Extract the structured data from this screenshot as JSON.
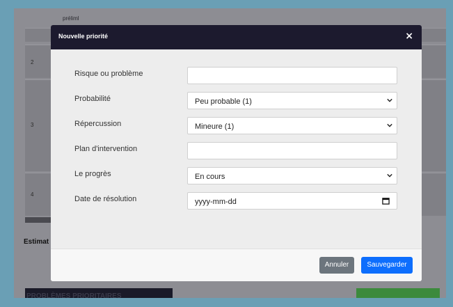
{
  "background_page": {
    "top_text": "préliml",
    "row_numbers": [
      "2",
      "3",
      "4"
    ],
    "estimate_label": "Estimat",
    "dark_banner_text": "PROBLÈMES PRIORITAIRES"
  },
  "modal": {
    "title": "Nouvelle priorité",
    "close_label": "×",
    "fields": [
      {
        "label": "Risque ou problème",
        "type": "text",
        "value": ""
      },
      {
        "label": "Probabilité",
        "type": "select",
        "value": "Peu probable (1)"
      },
      {
        "label": "Répercussion",
        "type": "select",
        "value": "Mineure (1)"
      },
      {
        "label": "Plan d'intervention",
        "type": "text",
        "value": ""
      },
      {
        "label": "Le progrès",
        "type": "select",
        "value": "En cours"
      },
      {
        "label": "Date de résolution",
        "type": "date",
        "value": "yyyy-mm-dd"
      }
    ],
    "buttons": {
      "cancel": "Annuler",
      "save": "Sauvegarder"
    }
  },
  "colors": {
    "modal_header": "#1c1a2e",
    "save_button": "#0d6efd",
    "cancel_button": "#6c757d"
  }
}
